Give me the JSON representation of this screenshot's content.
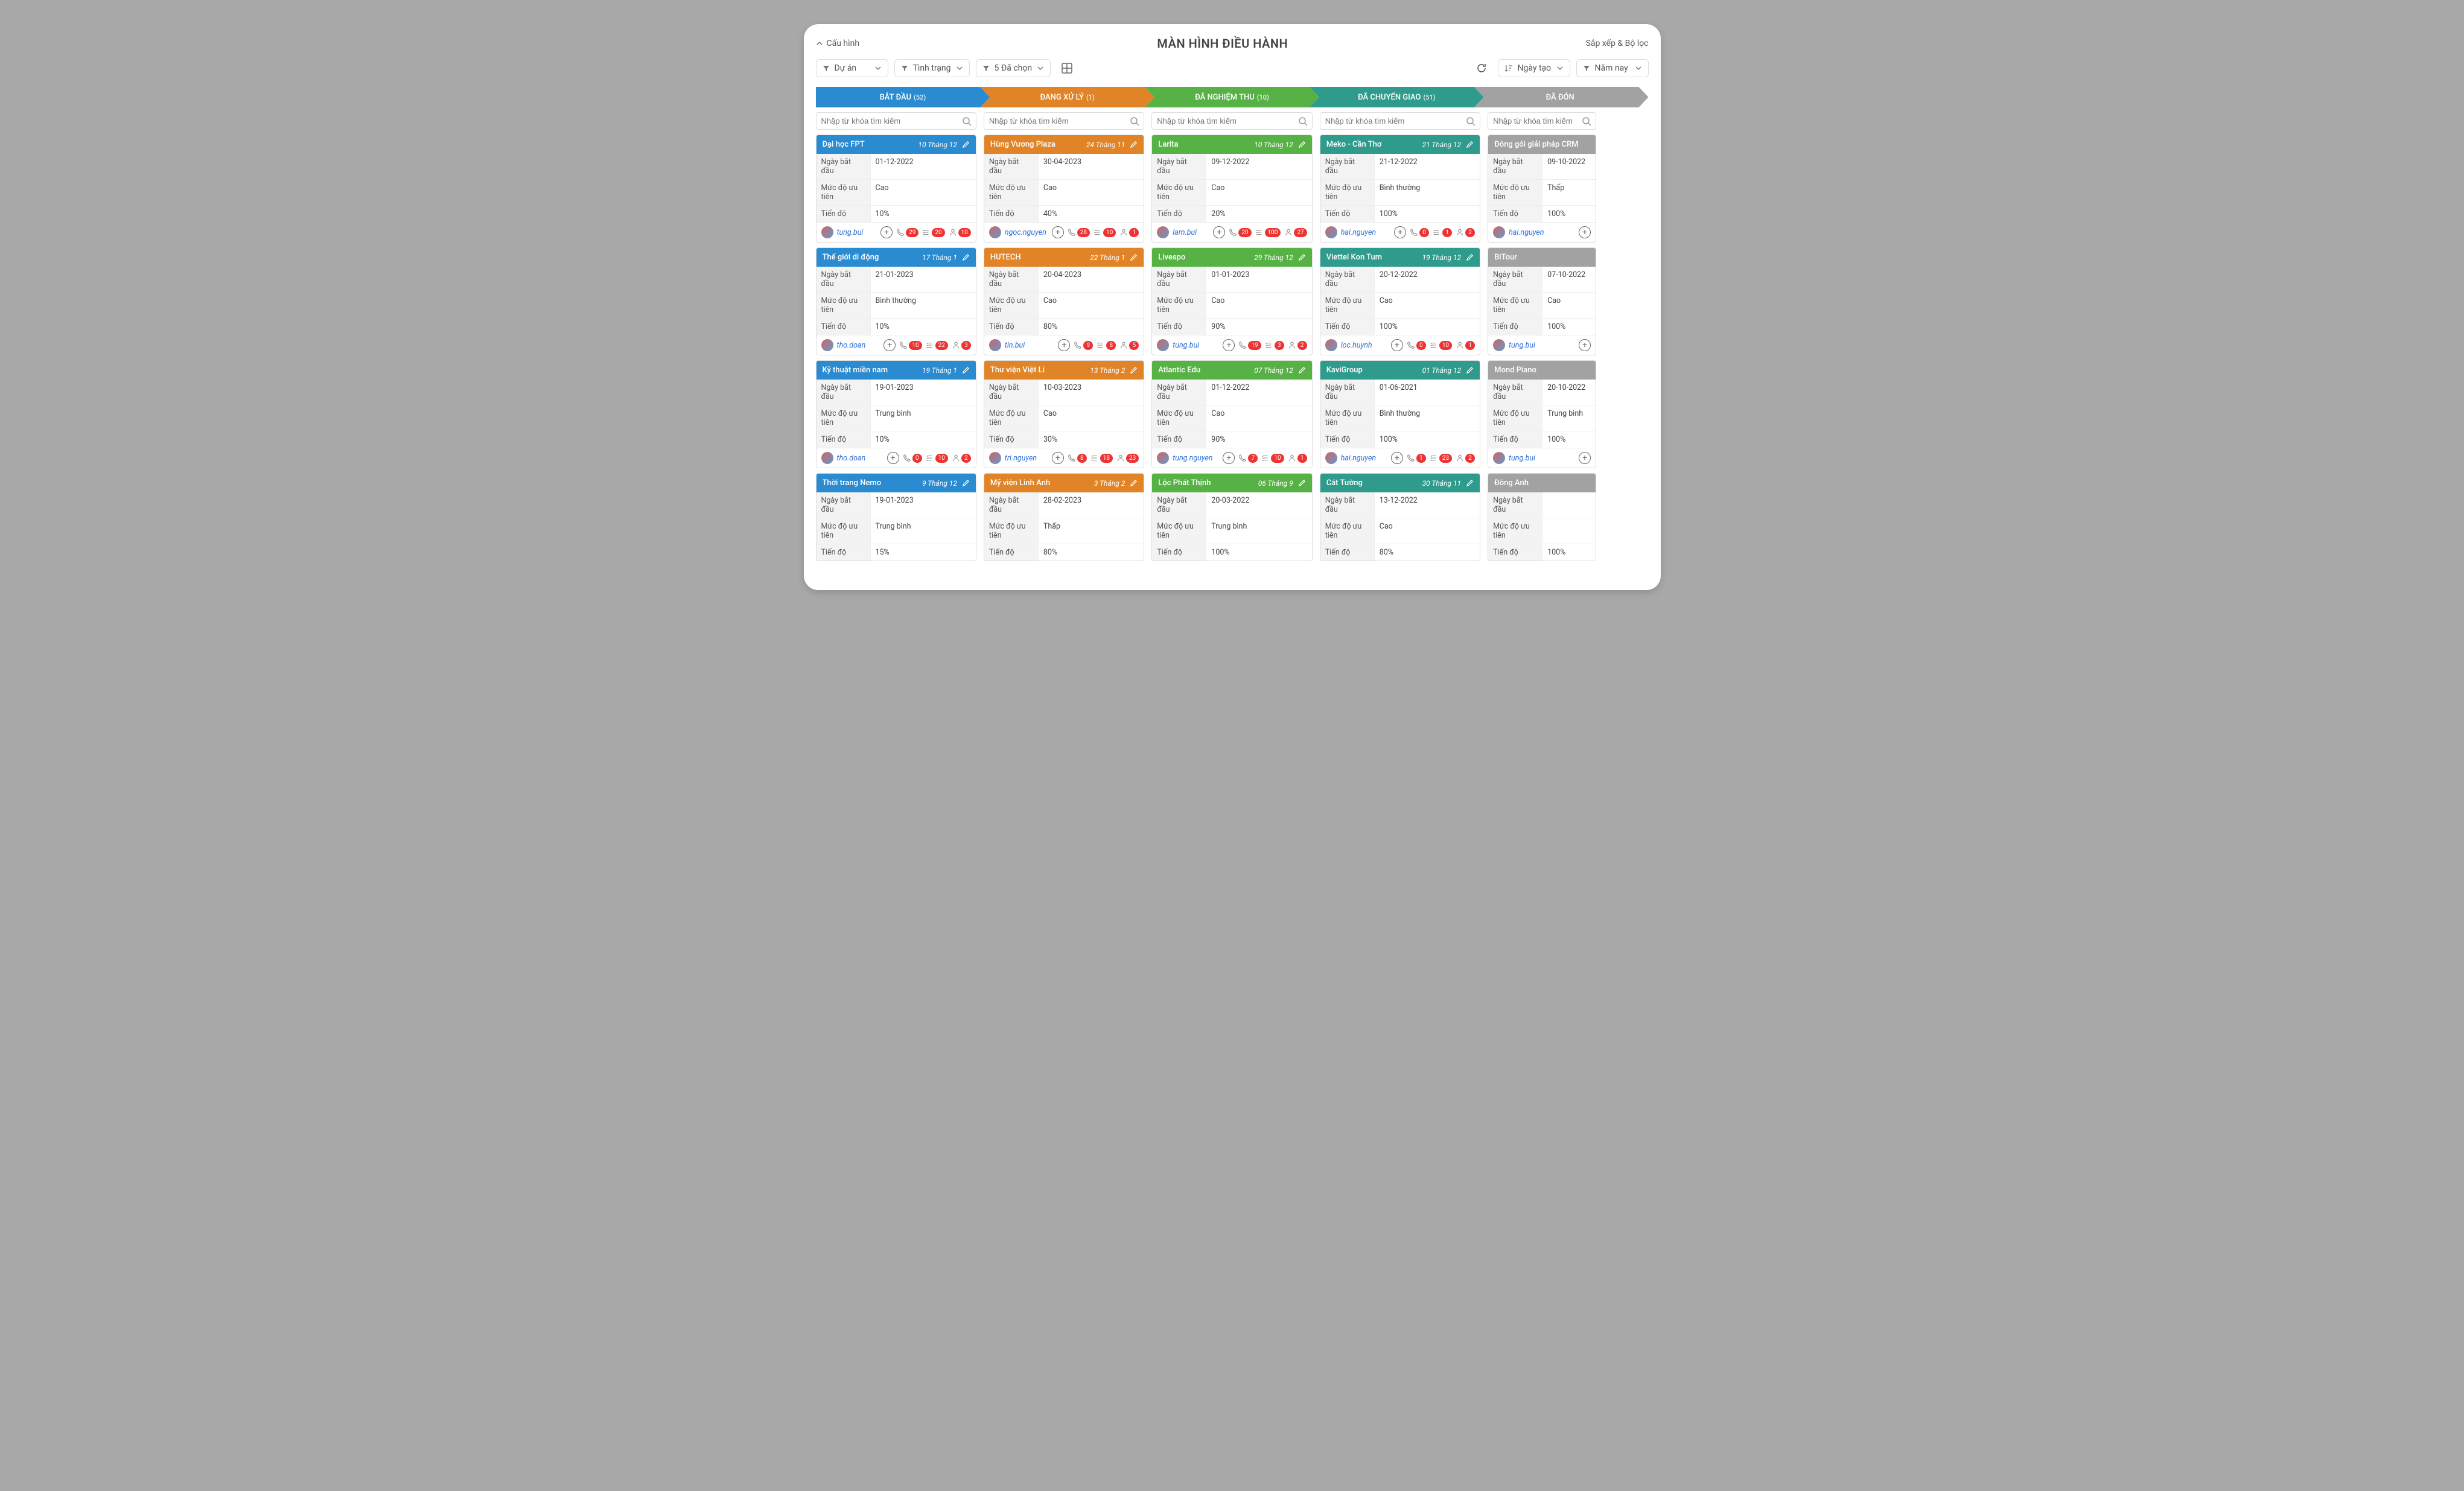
{
  "header": {
    "config": "Cấu hình",
    "title": "MÀN HÌNH ĐIỀU HÀNH",
    "sort_filter": "Sắp xếp & Bộ lọc"
  },
  "toolbar": {
    "project": "Dự án",
    "status": "Tình trạng",
    "selected": "5 Đã chọn",
    "created": "Ngày tạo",
    "year": "Năm nay"
  },
  "search_placeholder": "Nhập từ khóa tìm kiếm",
  "labels": {
    "start_date": "Ngày bắt đầu",
    "priority": "Mức độ ưu tiên",
    "progress": "Tiến độ"
  },
  "stages": [
    {
      "name": "BẮT ĐẦU",
      "count": "(52)",
      "cls": "c-blue"
    },
    {
      "name": "ĐANG XỬ LÝ",
      "count": "(1)",
      "cls": "c-orange"
    },
    {
      "name": "ĐÃ NGHIỆM THU",
      "count": "(10)",
      "cls": "c-green"
    },
    {
      "name": "ĐÃ CHUYỂN GIAO",
      "count": "(51)",
      "cls": "c-teal"
    },
    {
      "name": "ĐÃ ĐÓN",
      "count": "",
      "cls": "c-gray"
    }
  ],
  "columns": [
    {
      "cls": "c-blue",
      "cards": [
        {
          "title": "Đại học FPT",
          "date": "10 Tháng 12",
          "start": "01-12-2022",
          "priority": "Cao",
          "progress": "10%",
          "author": "tung.bui",
          "metrics": [
            "29",
            "20",
            "10"
          ]
        },
        {
          "title": "Thế giới di động",
          "date": "17 Tháng 1",
          "start": "21-01-2023",
          "priority": "Bình thường",
          "progress": "10%",
          "author": "tho.doan",
          "metrics": [
            "10",
            "22",
            "3"
          ]
        },
        {
          "title": "Kỹ thuật miền nam",
          "date": "19 Tháng 1",
          "start": "19-01-2023",
          "priority": "Trung bình",
          "progress": "10%",
          "author": "tho.doan",
          "metrics": [
            "0",
            "10",
            "2"
          ]
        },
        {
          "title": "Thời trang Nemo",
          "date": "9 Tháng 12",
          "start": "19-01-2023",
          "priority": "Trung bình",
          "progress": "15%",
          "author": "",
          "metrics": []
        }
      ]
    },
    {
      "cls": "c-orange",
      "cards": [
        {
          "title": "Hùng Vương Plaza",
          "date": "24 Tháng 11",
          "start": "30-04-2023",
          "priority": "Cao",
          "progress": "40%",
          "author": "ngoc.nguyen",
          "metrics": [
            "28",
            "10",
            "1"
          ]
        },
        {
          "title": "HUTECH",
          "date": "22 Tháng 1",
          "start": "20-04-2023",
          "priority": "Cao",
          "progress": "80%",
          "author": "tin.bui",
          "metrics": [
            "9",
            "8",
            "5"
          ]
        },
        {
          "title": "Thư viện Việt Li",
          "date": "13 Tháng 2",
          "start": "10-03-2023",
          "priority": "Cao",
          "progress": "30%",
          "author": "tri.nguyen",
          "metrics": [
            "8",
            "18",
            "23"
          ]
        },
        {
          "title": "Mỹ viện Linh Anh",
          "date": "3 Tháng 2",
          "start": "28-02-2023",
          "priority": "Thấp",
          "progress": "80%",
          "author": "",
          "metrics": []
        }
      ]
    },
    {
      "cls": "c-green",
      "cards": [
        {
          "title": "Larita",
          "date": "10 Tháng 12",
          "start": "09-12-2022",
          "priority": "Cao",
          "progress": "20%",
          "author": "lam.bui",
          "metrics": [
            "20",
            "100",
            "27"
          ]
        },
        {
          "title": "Livespo",
          "date": "29 Tháng 12",
          "start": "01-01-2023",
          "priority": "Cao",
          "progress": "90%",
          "author": "tung.bui",
          "metrics": [
            "19",
            "3",
            "2"
          ]
        },
        {
          "title": "Atlantic Edu",
          "date": "07 Tháng 12",
          "start": "01-12-2022",
          "priority": "Cao",
          "progress": "90%",
          "author": "tung.nguyen",
          "metrics": [
            "7",
            "10",
            "1"
          ]
        },
        {
          "title": "Lộc Phát Thịnh",
          "date": "06 Tháng 9",
          "start": "20-03-2022",
          "priority": "Trung bình",
          "progress": "100%",
          "author": "",
          "metrics": []
        }
      ]
    },
    {
      "cls": "c-teal",
      "cards": [
        {
          "title": "Meko - Cần Thơ",
          "date": "21 Tháng 12",
          "start": "21-12-2022",
          "priority": "Bình thường",
          "progress": "100%",
          "author": "hai.nguyen",
          "metrics": [
            "0",
            "1",
            "2"
          ]
        },
        {
          "title": "Viettel Kon Tum",
          "date": "19 Tháng 12",
          "start": "20-12-2022",
          "priority": "Cao",
          "progress": "100%",
          "author": "loc.huynh",
          "metrics": [
            "0",
            "10",
            "1"
          ]
        },
        {
          "title": "KaviGroup",
          "date": "01 Tháng 12",
          "start": "01-06-2021",
          "priority": "Bình thường",
          "progress": "100%",
          "author": "hai.nguyen",
          "metrics": [
            "1",
            "23",
            "2"
          ]
        },
        {
          "title": "Cát Tường",
          "date": "30 Tháng 11",
          "start": "13-12-2022",
          "priority": "Cao",
          "progress": "80%",
          "author": "",
          "metrics": []
        }
      ]
    },
    {
      "cls": "c-gray",
      "cards": [
        {
          "title": "Đóng gói giải pháp CRM",
          "date": "",
          "start": "09-10-2022",
          "priority": "Thấp",
          "progress": "100%",
          "author": "hai.nguyen",
          "metrics": []
        },
        {
          "title": "BiTour",
          "date": "",
          "start": "07-10-2022",
          "priority": "Cao",
          "progress": "100%",
          "author": "tung.bui",
          "metrics": []
        },
        {
          "title": "Mond Piano",
          "date": "",
          "start": "20-10-2022",
          "priority": "Trung bình",
          "progress": "100%",
          "author": "tung.bui",
          "metrics": []
        },
        {
          "title": "Đông Anh",
          "date": "",
          "start": "",
          "priority": "",
          "progress": "100%",
          "author": "",
          "metrics": []
        }
      ]
    }
  ]
}
